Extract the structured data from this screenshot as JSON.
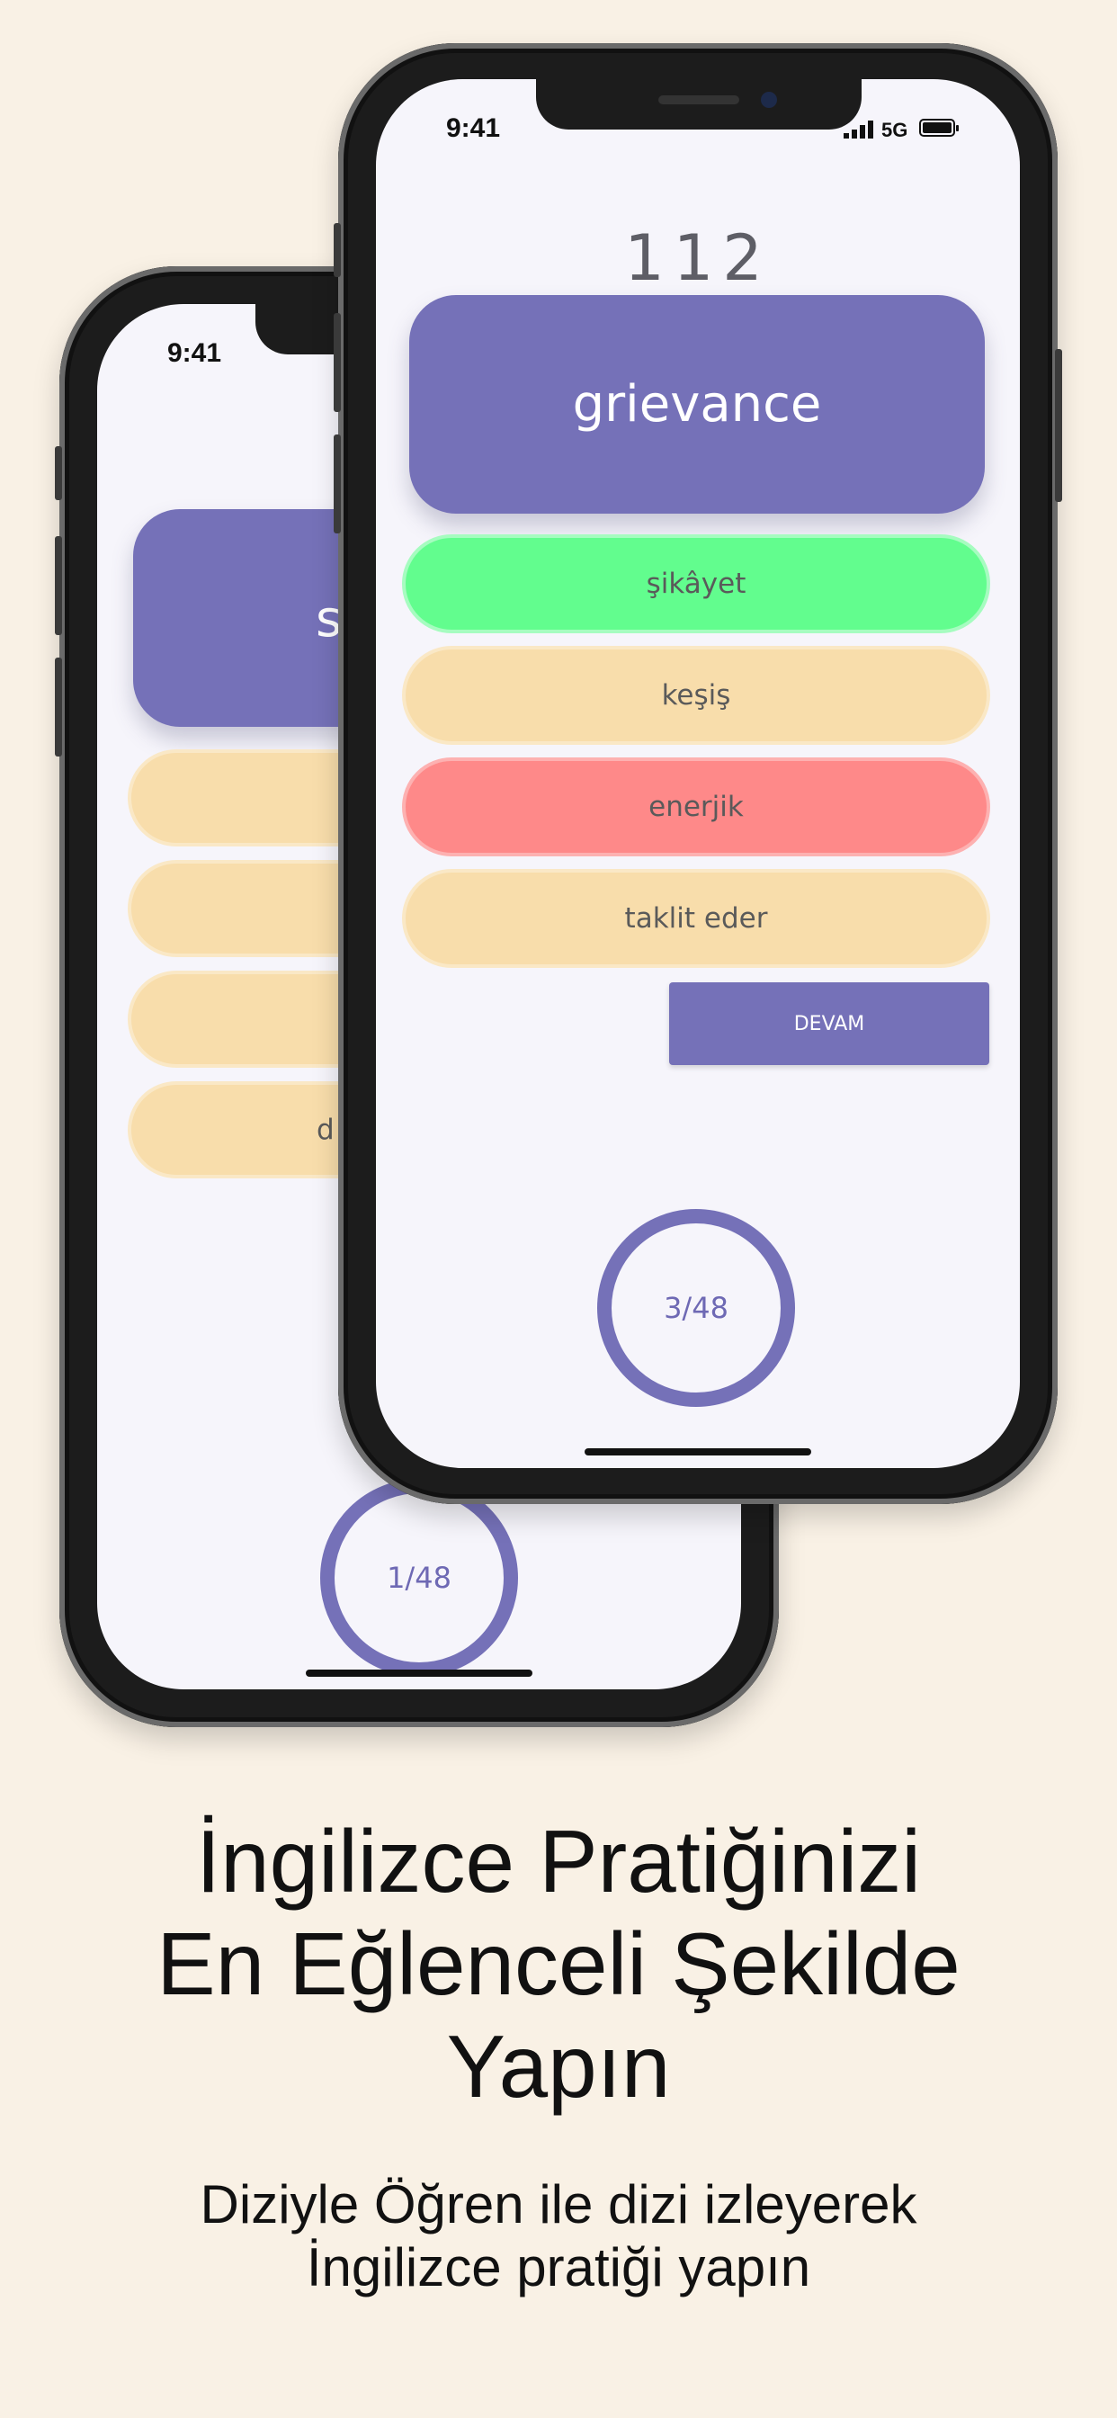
{
  "back_phone": {
    "status_time": "9:41",
    "word_partial": "s",
    "option_partial": "d",
    "progress": "1/48"
  },
  "front_phone": {
    "status_time": "9:41",
    "network": "5G",
    "counter": "112",
    "word": "grievance",
    "options": [
      {
        "label": "şikâyet",
        "state": "correct"
      },
      {
        "label": "keşiş",
        "state": "neutral"
      },
      {
        "label": "enerjik",
        "state": "wrong"
      },
      {
        "label": "taklit eder",
        "state": "neutral"
      }
    ],
    "continue_label": "DEVAM",
    "progress": "3/48"
  },
  "promo": {
    "headline_line1": "İngilizce Pratiğinizi",
    "headline_line2": "En Eğlenceli Şekilde",
    "headline_line3": "Yapın",
    "sub_line1": "Diziyle Öğren ile dizi izleyerek",
    "sub_line2": "İngilizce pratiği yapın"
  },
  "colors": {
    "background": "#f9f1e5",
    "accent": "#7571b8",
    "correct": "#62fd8e",
    "wrong": "#fe8989",
    "neutral": "#f8ddab"
  }
}
